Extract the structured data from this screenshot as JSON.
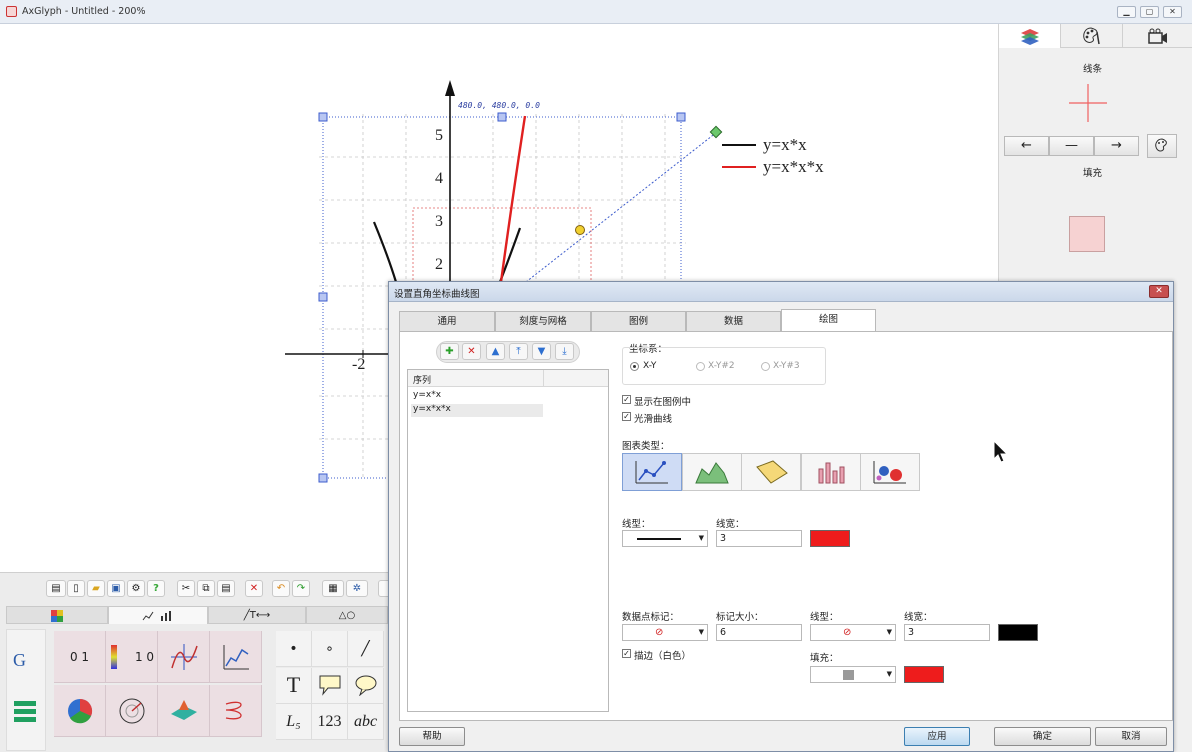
{
  "window": {
    "title": "AxGlyph - Untitled - 200%"
  },
  "canvas": {
    "coord_label": "480.0, 480.0, 0.0",
    "y_ticks": [
      "5",
      "4",
      "3",
      "2"
    ],
    "x_ticks": [
      "-2"
    ],
    "legend": [
      {
        "label": "y=x*x",
        "color": "#111111"
      },
      {
        "label": "y=x*x*x",
        "color": "#e02020"
      }
    ]
  },
  "right_panel": {
    "tabs": [
      "layers-icon",
      "palette-icon",
      "camera-icon"
    ],
    "line_label": "线条",
    "fill_label": "填充",
    "fill_color": "#f6d2d2",
    "arrows": [
      "←",
      "—",
      "→"
    ]
  },
  "bottom_tools": {
    "tabs": [
      "",
      "",
      "╱T⟷",
      "△○"
    ],
    "grid_a": [
      "0 1",
      "1 0",
      "",
      ""
    ],
    "grid_b": [
      "•",
      "∘",
      "╱",
      "T",
      "",
      "",
      "L₅",
      "123",
      "abc"
    ]
  },
  "dialog": {
    "title": "设置直角坐标曲线图",
    "tabs": [
      "通用",
      "刻度与网格",
      "图例",
      "数据",
      "绘图"
    ],
    "active_tab": "绘图",
    "series_header": "序列",
    "series": [
      "y=x*x",
      "y=x*x*x"
    ],
    "coord_system_label": "坐标系：",
    "coord_options": [
      "X-Y",
      "X-Y#2",
      "X-Y#3"
    ],
    "show_in_legend": "显示在图例中",
    "smooth_curve": "光滑曲线",
    "chart_type_label": "图表类型：",
    "line_type_label": "线型：",
    "line_width_label": "线宽：",
    "line_width_value": "3",
    "line_color": "#ee1c1c",
    "marker_label": "数据点标记：",
    "marker_size_label": "标记大小：",
    "marker_size_value": "6",
    "marker_line_type_label": "线型：",
    "marker_line_width_label": "线宽：",
    "marker_line_width_value": "3",
    "marker_line_color": "#000000",
    "outline_label": "描边（白色）",
    "fill_label": "填充：",
    "fill_color": "#ee1c1c",
    "help_button": "帮助",
    "apply_button": "应用",
    "ok_button": "确定",
    "cancel_button": "取消"
  }
}
